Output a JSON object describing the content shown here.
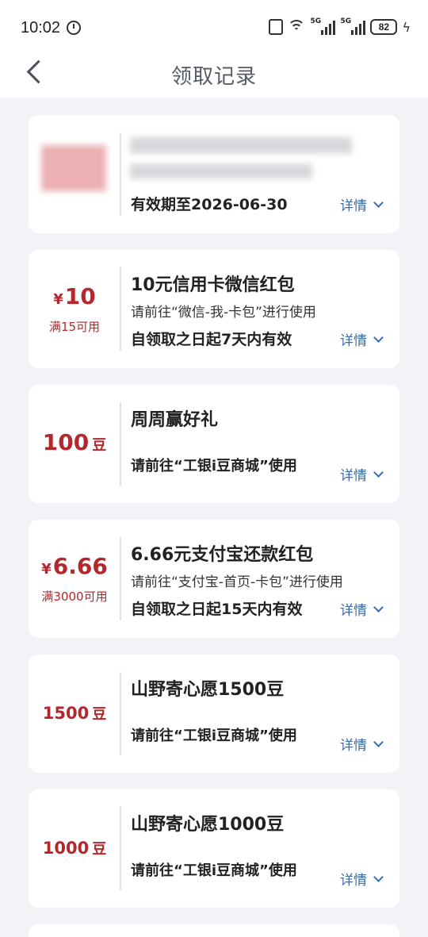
{
  "status": {
    "time": "10:02",
    "signal1": "5G",
    "signal2": "5G",
    "battery": "82"
  },
  "header": {
    "title": "领取记录"
  },
  "cards": [
    {
      "validity": "有效期至2026-06-30",
      "details": "详情"
    },
    {
      "amount": "10",
      "currency": "¥",
      "condition": "满15可用",
      "title": "10元信用卡微信红包",
      "desc": "请前往“微信-我-卡包”进行使用",
      "validity": "自领取之日起7天内有效",
      "details": "详情"
    },
    {
      "amount": "100",
      "unit": "豆",
      "title": "周周赢好礼",
      "usage": "请前往“工银i豆商城”使用",
      "details": "详情"
    },
    {
      "amount": "6.66",
      "currency": "¥",
      "condition": "满3000可用",
      "title": "6.66元支付宝还款红包",
      "desc": "请前往“支付宝-首页-卡包”进行使用",
      "validity": "自领取之日起15天内有效",
      "details": "详情"
    },
    {
      "amount": "1500",
      "unit": "豆",
      "title": "山野寄心愿1500豆",
      "usage": "请前往“工银i豆商城”使用",
      "details": "详情"
    },
    {
      "amount": "1000",
      "unit": "豆",
      "title": "山野寄心愿1000豆",
      "usage": "请前往“工银i豆商城”使用",
      "details": "详情"
    }
  ]
}
